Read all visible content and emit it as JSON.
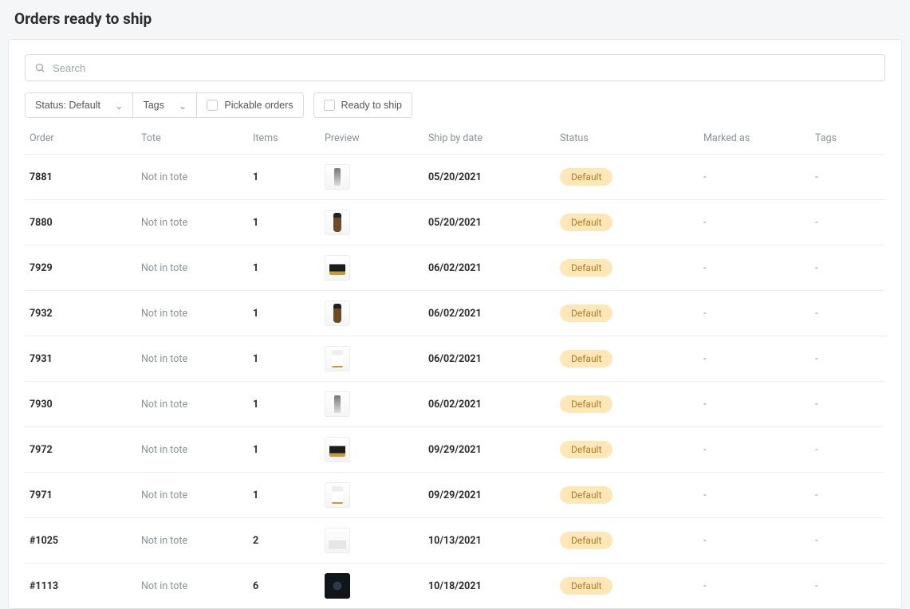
{
  "page_title": "Orders ready to ship",
  "search": {
    "placeholder": "Search"
  },
  "filters": {
    "status_label": "Status: Default",
    "tags_label": "Tags",
    "pickable_label": "Pickable orders",
    "ready_label": "Ready to ship"
  },
  "columns": {
    "order": "Order",
    "tote": "Tote",
    "items": "Items",
    "preview": "Preview",
    "ship_by": "Ship by date",
    "status": "Status",
    "marked_as": "Marked as",
    "tags": "Tags"
  },
  "rows": [
    {
      "order": "7881",
      "tote": "Not in tote",
      "items": "1",
      "preview": "pen",
      "ship_by": "05/20/2021",
      "status": "Default",
      "marked": "-",
      "tags": "-"
    },
    {
      "order": "7880",
      "tote": "Not in tote",
      "items": "1",
      "preview": "drop",
      "ship_by": "05/20/2021",
      "status": "Default",
      "marked": "-",
      "tags": "-"
    },
    {
      "order": "7929",
      "tote": "Not in tote",
      "items": "1",
      "preview": "jar",
      "ship_by": "06/02/2021",
      "status": "Default",
      "marked": "-",
      "tags": "-"
    },
    {
      "order": "7932",
      "tote": "Not in tote",
      "items": "1",
      "preview": "drop",
      "ship_by": "06/02/2021",
      "status": "Default",
      "marked": "-",
      "tags": "-"
    },
    {
      "order": "7931",
      "tote": "Not in tote",
      "items": "1",
      "preview": "pump",
      "ship_by": "06/02/2021",
      "status": "Default",
      "marked": "-",
      "tags": "-"
    },
    {
      "order": "7930",
      "tote": "Not in tote",
      "items": "1",
      "preview": "pen",
      "ship_by": "06/02/2021",
      "status": "Default",
      "marked": "-",
      "tags": "-"
    },
    {
      "order": "7972",
      "tote": "Not in tote",
      "items": "1",
      "preview": "jar",
      "ship_by": "09/29/2021",
      "status": "Default",
      "marked": "-",
      "tags": "-"
    },
    {
      "order": "7971",
      "tote": "Not in tote",
      "items": "1",
      "preview": "pump",
      "ship_by": "09/29/2021",
      "status": "Default",
      "marked": "-",
      "tags": "-"
    },
    {
      "order": "#1025",
      "tote": "Not in tote",
      "items": "2",
      "preview": "box",
      "ship_by": "10/13/2021",
      "status": "Default",
      "marked": "-",
      "tags": "-"
    },
    {
      "order": "#1113",
      "tote": "Not in tote",
      "items": "6",
      "preview": "dark",
      "ship_by": "10/18/2021",
      "status": "Default",
      "marked": "-",
      "tags": "-"
    }
  ]
}
